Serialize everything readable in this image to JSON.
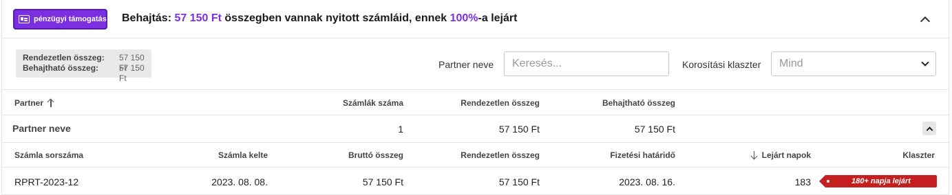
{
  "header": {
    "badge_label": "pénzügyi támogatás",
    "title_prefix": "Behajtás: ",
    "title_amount": "57 150 Ft",
    "title_middle": " összegben vannak nyitott számláid, ennek ",
    "title_percent": "100%",
    "title_suffix": "-a lejárt"
  },
  "summary": {
    "unsettled_label": "Rendezetlen összeg:",
    "unsettled_value": "57 150 Ft",
    "collectible_label": "Behajtható összeg:",
    "collectible_value": "57 150 Ft"
  },
  "filters": {
    "partner_label": "Partner neve",
    "partner_placeholder": "Keresés...",
    "cluster_label": "Korosítási klaszter",
    "cluster_value": "Mind"
  },
  "partner_table": {
    "headers": {
      "partner": "Partner",
      "invoice_count": "Számlák száma",
      "unsettled": "Rendezetlen összeg",
      "collectible": "Behajtható összeg"
    },
    "group": {
      "name": "Partner neve",
      "invoice_count": "1",
      "unsettled": "57 150 Ft",
      "collectible": "57 150 Ft"
    }
  },
  "invoice_table": {
    "headers": {
      "number": "Számla sorszáma",
      "issue_date": "Számla kelte",
      "gross": "Bruttó összeg",
      "unsettled": "Rendezetlen összeg",
      "due_date": "Fizetési határidő",
      "overdue_days": "Lejárt napok",
      "cluster": "Klaszter"
    },
    "rows": [
      {
        "number": "RPRT-2023-12",
        "issue_date": "2023. 08. 08.",
        "gross": "57 150 Ft",
        "unsettled": "57 150 Ft",
        "due_date": "2023. 08. 16.",
        "overdue_days": "183",
        "cluster": "180+ napja lejárt"
      }
    ]
  },
  "colors": {
    "accent": "#7a2fe0",
    "danger": "#c41e1e"
  }
}
